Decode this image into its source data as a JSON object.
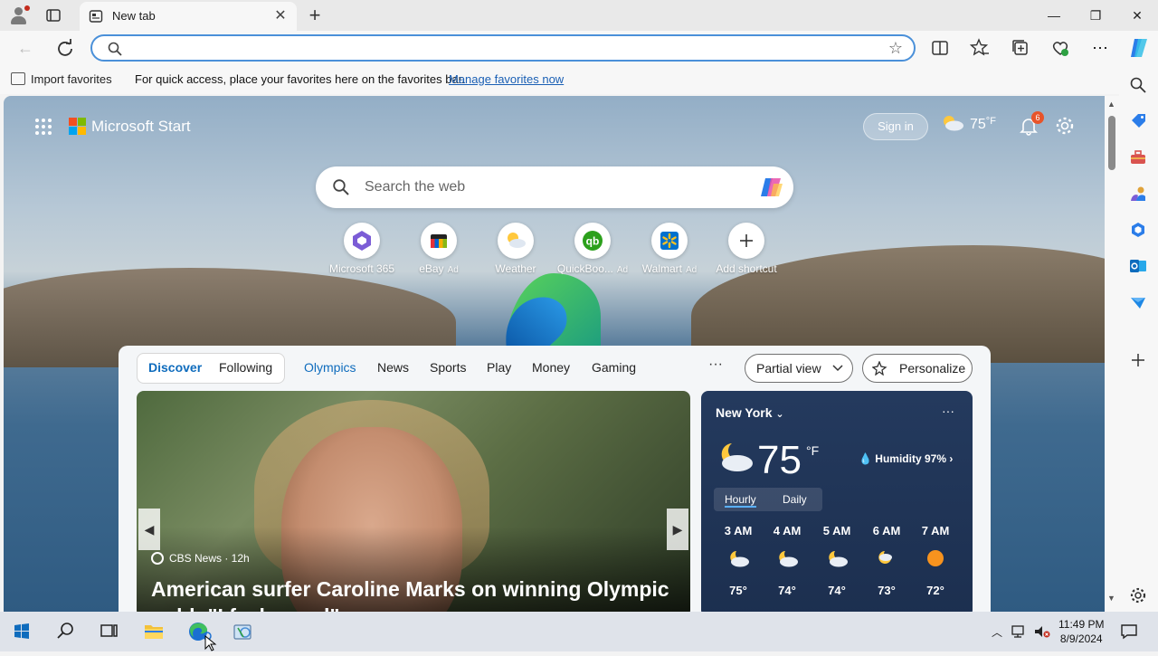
{
  "browser": {
    "tab_title": "New tab",
    "address_value": "",
    "favbar": {
      "import_label": "Import favorites",
      "message": "For quick access, place your favorites here on the favorites bar.",
      "manage_link": "Manage favorites now"
    }
  },
  "start": {
    "brand": "Microsoft Start",
    "sign_in": "Sign in",
    "weather_temp": "75",
    "weather_unit": "°F",
    "notifications": "6",
    "search_placeholder": "Search the web",
    "shortcuts": [
      {
        "label": "Microsoft 365",
        "ad": ""
      },
      {
        "label": "eBay",
        "ad": "Ad"
      },
      {
        "label": "Weather",
        "ad": ""
      },
      {
        "label": "QuickBoo...",
        "ad": "Ad"
      },
      {
        "label": "Walmart",
        "ad": "Ad"
      },
      {
        "label": "Add shortcut",
        "ad": ""
      }
    ]
  },
  "feed": {
    "pivots": [
      "Discover",
      "Following",
      "Olympics",
      "News",
      "Sports",
      "Play",
      "Money",
      "Gaming"
    ],
    "more": "···",
    "partial_view": "Partial view",
    "personalize": "Personalize",
    "hero": {
      "source": "CBS News · 12h",
      "headline": "American surfer Caroline Marks on winning Olympic gold: \"I feel proud\""
    }
  },
  "weather": {
    "location": "New York",
    "more": "···",
    "temp": "75",
    "unit": "°F",
    "humidity": "Humidity 97%",
    "tabs": [
      "Hourly",
      "Daily"
    ],
    "hours": [
      {
        "time": "3 AM",
        "temp": "75°",
        "icon": "partly-cloudy-night-icon"
      },
      {
        "time": "4 AM",
        "temp": "74°",
        "icon": "partly-cloudy-night-icon"
      },
      {
        "time": "5 AM",
        "temp": "74°",
        "icon": "partly-cloudy-night-icon"
      },
      {
        "time": "6 AM",
        "temp": "73°",
        "icon": "partly-cloudy-night-icon"
      },
      {
        "time": "7 AM",
        "temp": "72°",
        "icon": "sun-icon"
      }
    ]
  },
  "taskbar": {
    "time": "11:49 PM",
    "date": "8/9/2024"
  },
  "colors": {
    "accent": "#0f6cbd",
    "edge_blue": "#1b6fd1",
    "edge_green": "#3fbf5f"
  }
}
